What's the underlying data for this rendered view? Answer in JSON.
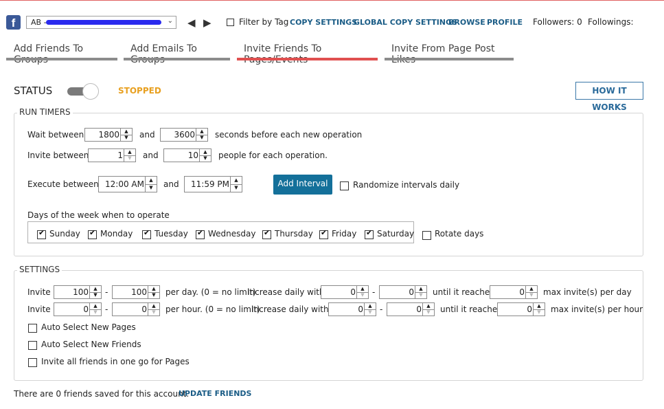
{
  "header": {
    "account_prefix": "AB -",
    "filter_by_tag": "Filter by Tag",
    "links": [
      "COPY SETTINGS",
      "GLOBAL COPY SETTINGS",
      "BROWSE",
      "PROFILE"
    ],
    "followers": "Followers: 0",
    "followings": "Followings:"
  },
  "tabs": [
    {
      "label": "Add Friends To Groups",
      "active": false
    },
    {
      "label": "Add Emails To Groups",
      "active": false
    },
    {
      "label": "Invite Friends To Pages/Events",
      "active": true
    },
    {
      "label": "Invite From Page Post Likes",
      "active": false
    }
  ],
  "status": {
    "label": "STATUS",
    "state": "STOPPED",
    "state_color": "#e8a020",
    "how_it_works": "HOW IT WORKS"
  },
  "run_timers": {
    "legend": "RUN TIMERS",
    "wait_label": "Wait between",
    "wait_min": "1800",
    "and": "and",
    "wait_max": "3600",
    "wait_suffix": "seconds before each new operation",
    "invite_label": "Invite between",
    "invite_min": "1",
    "invite_max": "10",
    "invite_suffix": "people for each operation.",
    "execute_label": "Execute between",
    "execute_start": "12:00 AM",
    "execute_end": "11:59 PM",
    "add_interval": "Add Interval",
    "randomize": "Randomize intervals daily",
    "days_label": "Days of the week when to operate",
    "days": [
      "Sunday",
      "Monday",
      "Tuesday",
      "Wednesday",
      "Thursday",
      "Friday",
      "Saturday"
    ],
    "rotate_days": "Rotate days"
  },
  "settings": {
    "legend": "SETTINGS",
    "invite": "Invite",
    "dash": "-",
    "day_min": "100",
    "day_max": "100",
    "per_day": "per day. (0 = no limit)",
    "increase": "Increase daily with",
    "day_inc_min": "0",
    "day_inc_max": "0",
    "until": "until it reaches",
    "day_cap": "0",
    "max_day": "max invite(s) per day",
    "hour_min": "0",
    "hour_max": "0",
    "per_hour": "per hour. (0 = no limit)",
    "hour_inc_min": "0",
    "hour_inc_max": "0",
    "hour_cap": "0",
    "max_hour": "max invite(s) per hour",
    "auto_pages": "Auto Select New Pages",
    "auto_friends": "Auto Select New Friends",
    "invite_all": "Invite all friends in one go for Pages"
  },
  "footer": {
    "saved_text": "There are 0 friends saved for this account.",
    "update_friends": "UPDATE FRIENDS"
  },
  "icons": {
    "spin_up": "▲",
    "spin_down": "▼",
    "dropdown": "⌄",
    "prev": "◀",
    "next": "▶",
    "fb": "f"
  }
}
